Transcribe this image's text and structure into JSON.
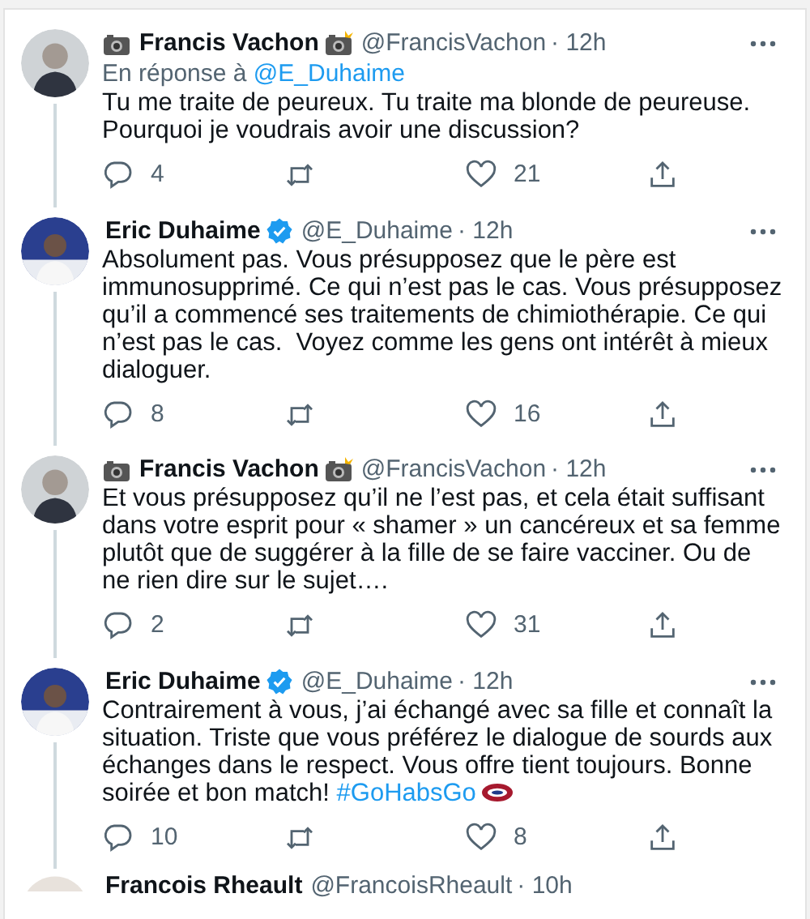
{
  "tweets": [
    {
      "name": "Francis Vachon",
      "camera_icons": true,
      "verified": false,
      "handle": "@FrancisVachon",
      "time": "· 12h",
      "reply_to": {
        "prefix": "En réponse à",
        "mention": "@E_Duhaime"
      },
      "text": "Tu me traite de peureux. Tu traite ma blonde de peureuse. Pourquoi je voudrais avoir une discussion?",
      "replies": "4",
      "likes": "21"
    },
    {
      "name": "Eric Duhaime",
      "camera_icons": false,
      "verified": true,
      "handle": "@E_Duhaime",
      "time": "· 12h",
      "text": "Absolument pas. Vous présupposez que le père est immunosupprimé. Ce qui n’est pas le cas. Vous présupposez qu’il a commencé ses traitements de chimiothérapie. Ce qui n’est pas le cas.  Voyez comme les gens ont intérêt à mieux dialoguer.",
      "replies": "8",
      "likes": "16"
    },
    {
      "name": "Francis Vachon",
      "camera_icons": true,
      "verified": false,
      "handle": "@FrancisVachon",
      "time": "· 12h",
      "text": "Et vous présupposez qu’il ne l’est pas, et cela était suffisant dans votre esprit pour « shamer » un cancéreux et sa femme plutôt que de suggérer à la fille de se faire vacciner. Ou de ne rien dire sur le sujet….",
      "replies": "2",
      "likes": "31"
    },
    {
      "name": "Eric Duhaime",
      "camera_icons": false,
      "verified": true,
      "handle": "@E_Duhaime",
      "time": "· 12h",
      "text": "Contrairement à vous, j’ai échangé avec sa fille et connaît la situation. Triste que vous préférez le dialogue de sourds aux échanges dans le respect. Vous offre tient toujours. Bonne soirée et bon match!",
      "hashtag": "#GoHabsGo",
      "hashtag_emoji": true,
      "replies": "10",
      "likes": "8"
    }
  ],
  "next_tweet": {
    "name": "Francois Rheault",
    "handle": "@FrancoisRheault",
    "time": "· 10h"
  }
}
